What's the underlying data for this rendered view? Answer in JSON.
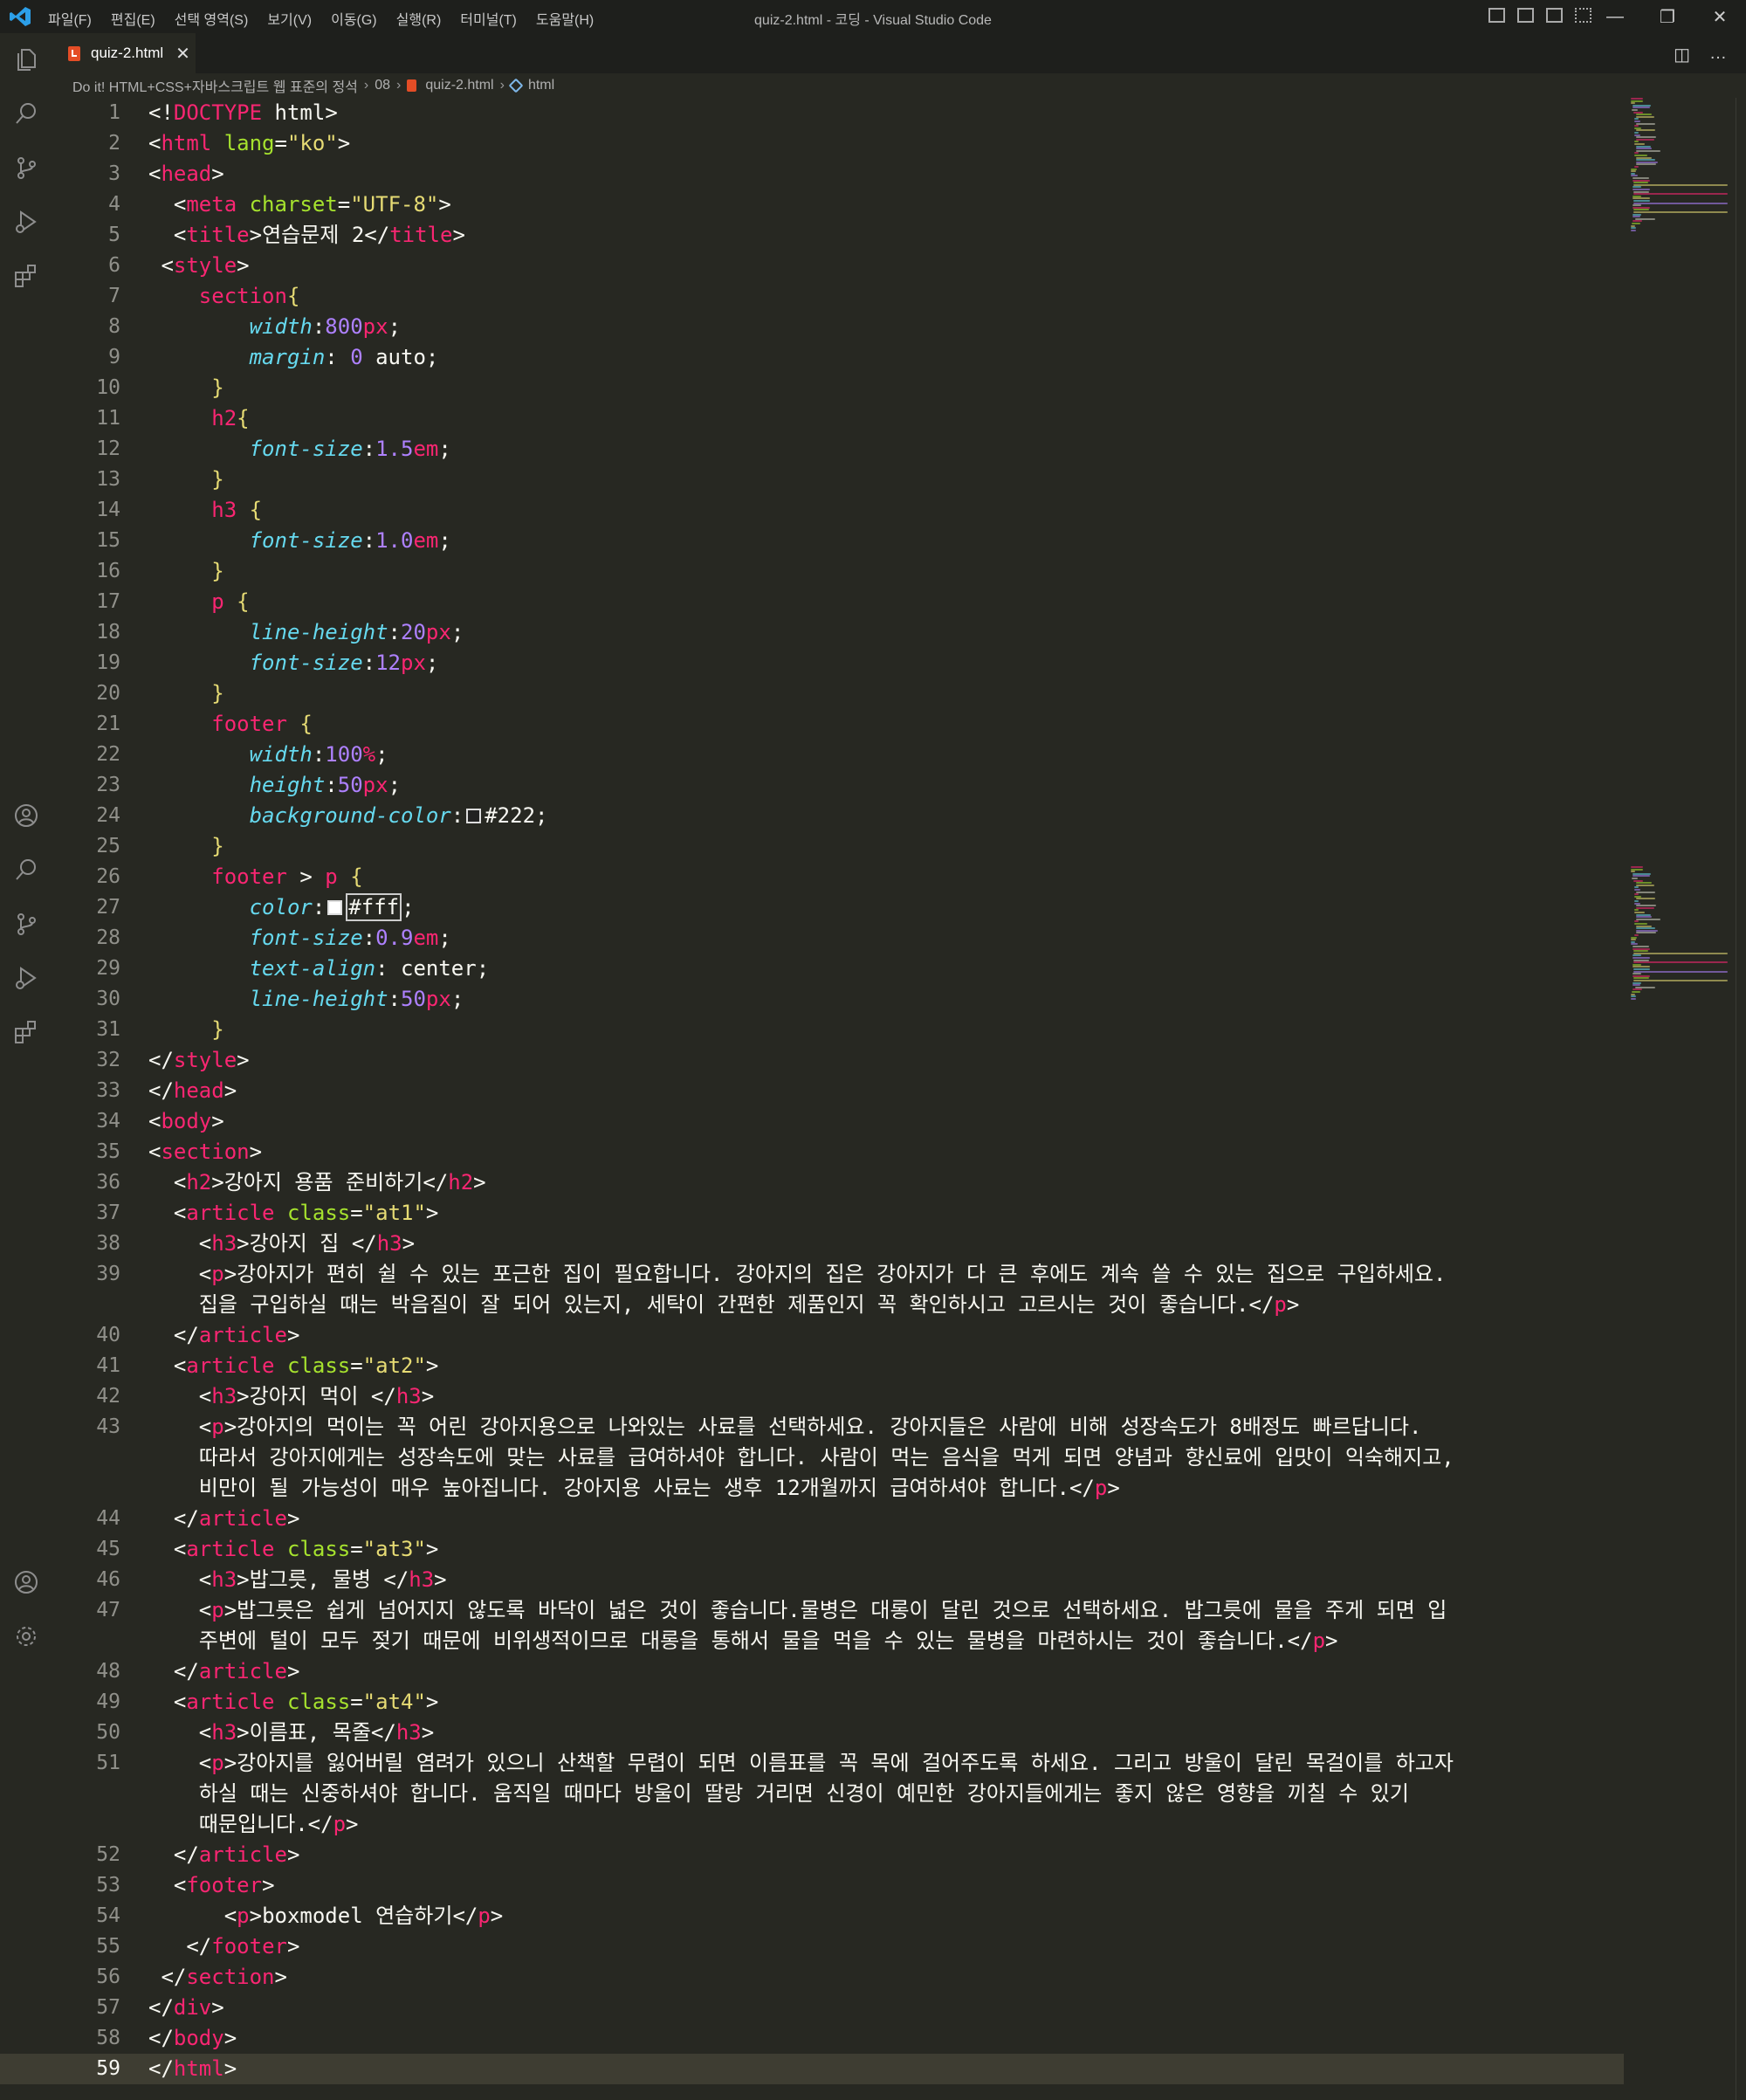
{
  "window": {
    "title": "quiz-2.html - 코딩 - Visual Studio Code",
    "menus": [
      "파일(F)",
      "편집(E)",
      "선택 영역(S)",
      "보기(V)",
      "이동(G)",
      "실행(R)",
      "터미널(T)",
      "도움말(H)"
    ],
    "controls": {
      "minimize": "—",
      "maximize": "❐",
      "close": "✕"
    }
  },
  "activity_bar": [
    "files-icon",
    "search-icon",
    "source-control-icon",
    "run-debug-icon",
    "extensions-icon",
    "account-icon",
    "settings-gear-icon"
  ],
  "tab": {
    "label": "quiz-2.html",
    "close": "✕"
  },
  "editor_actions": {
    "split": "◫",
    "more": "…"
  },
  "breadcrumb": [
    "Do it! HTML+CSS+자바스크립트 웹 표준의 정석",
    "08",
    "quiz-2.html",
    "html"
  ],
  "lines": [
    "<!DOCTYPE html>",
    "<html lang=\"ko\">",
    "<head>",
    "  <meta charset=\"UTF-8\">",
    "  <title>연습문제 2</title>",
    " <style>",
    "    section{",
    "        width:800px;",
    "        margin: 0 auto;",
    "     }",
    "     h2{",
    "        font-size:1.5em;",
    "     }",
    "     h3 {",
    "        font-size:1.0em;",
    "     }",
    "     p {",
    "        line-height:20px;",
    "        font-size:12px;",
    "     }",
    "     footer {",
    "        width:100%;",
    "        height:50px;",
    "        background-color: #222;",
    "     }",
    "     footer > p {",
    "        color: #fff;",
    "        font-size:0.9em;",
    "        text-align: center;",
    "        line-height:50px;",
    "     }",
    "</style>",
    "</head>",
    "<body>",
    "<section>",
    "  <h2>강아지 용품 준비하기</h2>",
    "  <article class=\"at1\">",
    "    <h3>강아지 집 </h3>",
    "    <p>강아지가 편히 쉴 수 있는 포근한 집이 필요합니다. 강아지의 집은 강아지가 다 큰 후에도 계속 쓸 수 있는 집으로 구입하세요. 집을 구입하실 때는 박음질이 잘 되어 있는지, 세탁이 간편한 제품인지 꼭 확인하시고 고르시는 것이 좋습니다.</p>",
    "  </article>",
    "  <article class=\"at2\">",
    "    <h3>강아지 먹이 </h3>",
    "    <p>강아지의 먹이는 꼭 어린 강아지용으로 나와있는 사료를 선택하세요. 강아지들은 사람에 비해 성장속도가 8배정도 빠르답니다. 따라서 강아지에게는 성장속도에 맞는 사료를 급여하셔야 합니다. 사람이 먹는 음식을 먹게 되면 양념과 향신료에 입맛이 익숙해지고, 비만이 될 가능성이 매우 높아집니다. 강아지용 사료는 생후 12개월까지 급여하셔야 합니다.</p>",
    "  </article>",
    "  <article class=\"at3\">",
    "    <h3>밥그릇, 물병 </h3>",
    "    <p>밥그릇은 쉽게 넘어지지 않도록 바닥이 넓은 것이 좋습니다.물병은 대롱이 달린 것으로 선택하세요. 밥그릇에 물을 주게 되면 입 주변에 털이 모두 젖기 때문에 비위생적이므로 대롱을 통해서 물을 먹을 수 있는 물병을 마련하시는 것이 좋습니다.</p>",
    "  </article>",
    "  <article class=\"at4\">",
    "    <h3>이름표, 목줄</h3>",
    "    <p>강아지를 잃어버릴 염려가 있으니 산책할 무렵이 되면 이름표를 꼭 목에 걸어주도록 하세요. 그리고 방울이 달린 목걸이를 하고자 하실 때는 신중하셔야 합니다. 움직일 때마다 방울이 딸랑 거리면 신경이 예민한 강아지들에게는 좋지 않은 영향을 끼칠 수 있기 때문입니다.</p>",
    "  </article>",
    "  <footer>",
    "      <p>boxmodel 연습하기</p>",
    "   </footer>",
    " </section>",
    "</div>",
    "</body>",
    "</html>"
  ],
  "current_line": 59,
  "colors": {
    "background": "#272822",
    "tag": "#f92672",
    "attribute": "#a6e22e",
    "string": "#e6db74",
    "property": "#66d9ef",
    "number": "#ae81ff"
  }
}
